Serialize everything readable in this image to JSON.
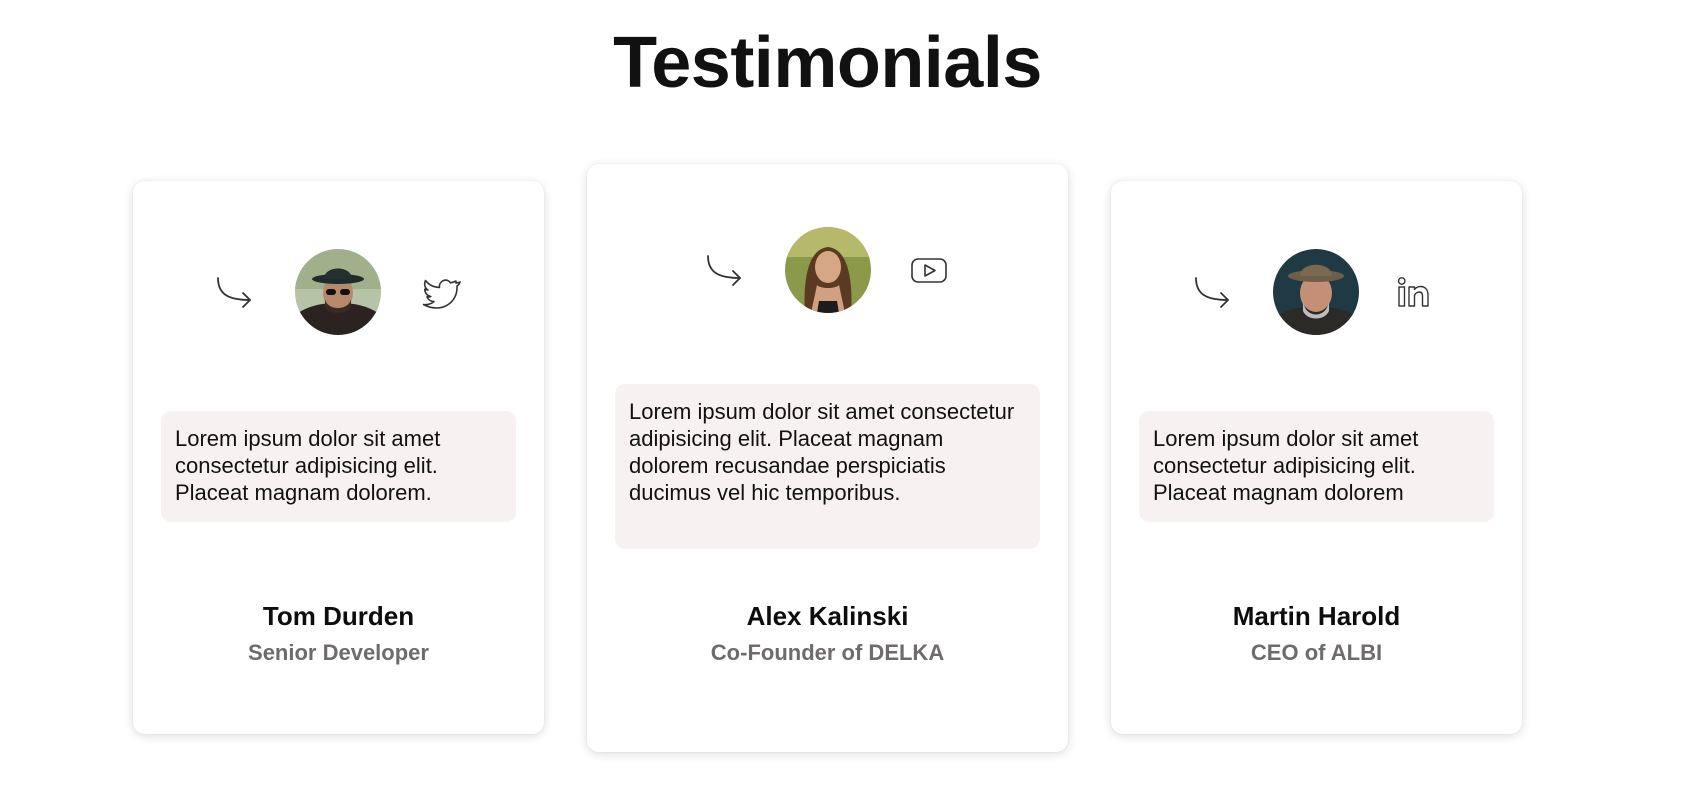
{
  "page": {
    "title": "Testimonials"
  },
  "colors": {
    "background": "#ffffff",
    "card": "#ffffff",
    "quote_background": "#f7f1f1",
    "text": "#111111",
    "role_text": "#6f6b6b",
    "icon_stroke": "#333333"
  },
  "testimonials": [
    {
      "name": "Tom Durden",
      "role": "Senior Developer",
      "quote": "Lorem ipsum dolor sit amet consectetur adipisicing elit. Placeat magnam dolorem.",
      "social_icon": "twitter-icon",
      "arrow_icon": "curved-arrow-icon"
    },
    {
      "name": "Alex Kalinski",
      "role": "Co-Founder of DELKA",
      "quote": "Lorem ipsum dolor sit amet consectetur adipisicing elit. Placeat magnam dolorem recusandae perspiciatis ducimus vel hic temporibus.",
      "social_icon": "youtube-icon",
      "arrow_icon": "curved-arrow-icon"
    },
    {
      "name": "Martin Harold",
      "role": "CEO of ALBI",
      "quote": "Lorem ipsum dolor sit amet consectetur adipisicing elit. Placeat magnam dolorem",
      "social_icon": "linkedin-icon",
      "arrow_icon": "curved-arrow-icon"
    }
  ]
}
